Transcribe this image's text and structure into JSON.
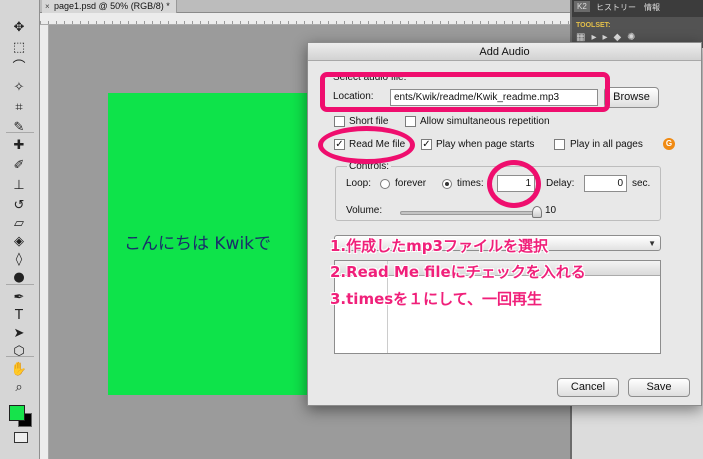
{
  "document": {
    "tab_title": "page1.psd @ 50% (RGB/8) *",
    "canvas_text": "こんにちは Kwikで"
  },
  "colors": {
    "page_green": "#0ee34a",
    "annotation_pink": "#ef0e6e",
    "foreground_swatch": "#16e34b",
    "background_swatch": "#000000"
  },
  "right_panel": {
    "tabs": [
      "K2",
      "ヒストリー",
      "情報"
    ],
    "toolset_label": "TOOLSET:"
  },
  "dialog": {
    "title": "Add Audio",
    "select_label": "Select audio file:",
    "location_label": "Location:",
    "location_value": "ents/Kwik/readme/Kwik_readme.mp3",
    "browse_label": "Browse",
    "short_file_label": "Short file",
    "short_file_checked": false,
    "allow_sim_label": "Allow simultaneous repetition",
    "allow_sim_checked": false,
    "read_me_label": "Read Me file",
    "read_me_checked": true,
    "play_when_label": "Play when page starts",
    "play_when_checked": true,
    "play_all_label": "Play in all pages",
    "play_all_checked": false,
    "controls_label": "Controls:",
    "loop_label": "Loop:",
    "forever_label": "forever",
    "times_label": "times:",
    "times_value": "1",
    "delay_label": "Delay:",
    "delay_value": "0",
    "sec_label": "sec.",
    "volume_label": "Volume:",
    "volume_value": "10",
    "volume_level_fraction": 1.0,
    "cancel_label": "Cancel",
    "save_label": "Save"
  },
  "annotations": [
    "1.作成したmp3ファイルを選択",
    "2.Read Me fileにチェックを入れる",
    "3.timesを１にして、一回再生"
  ]
}
